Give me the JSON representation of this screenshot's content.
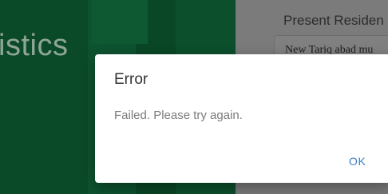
{
  "background": {
    "banner_title": "istics",
    "panel_heading": "Present Residen",
    "panel_field_value": "New Tariq abad mu"
  },
  "dialog": {
    "title": "Error",
    "message": "Failed. Please try again.",
    "ok_label": "OK"
  },
  "colors": {
    "accent": "#3a7fc4",
    "banner_green": "#0a4a26",
    "overlay": "#7a7a7a"
  }
}
